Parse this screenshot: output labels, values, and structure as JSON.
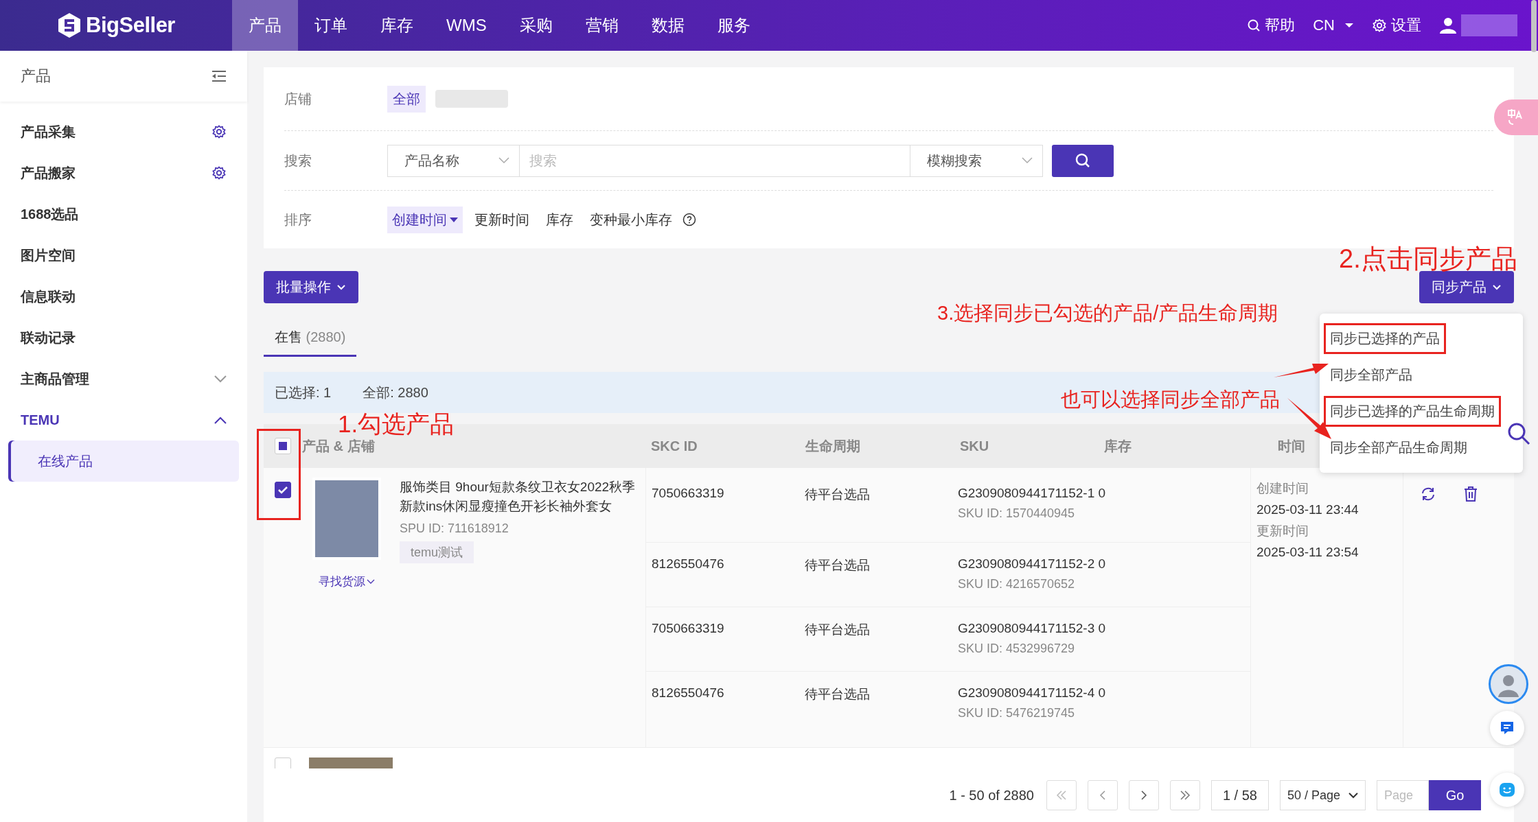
{
  "top_nav": {
    "logo": "BigSeller",
    "items": [
      {
        "label": "产品",
        "selected": true
      },
      {
        "label": "订单",
        "selected": false
      },
      {
        "label": "库存",
        "selected": false
      },
      {
        "label": "WMS",
        "selected": false
      },
      {
        "label": "采购",
        "selected": false
      },
      {
        "label": "营销",
        "selected": false
      },
      {
        "label": "数据",
        "selected": false
      },
      {
        "label": "服务",
        "selected": false
      }
    ],
    "help": "帮助",
    "language": "CN",
    "settings": "设置"
  },
  "sidebar": {
    "title": "产品",
    "items": [
      {
        "label": "产品采集",
        "kind": "gear"
      },
      {
        "label": "产品搬家",
        "kind": "gear"
      },
      {
        "label": "1688选品",
        "kind": "plain"
      },
      {
        "label": "图片空间",
        "kind": "plain"
      },
      {
        "label": "信息联动",
        "kind": "plain"
      },
      {
        "label": "联动记录",
        "kind": "plain"
      },
      {
        "label": "主商品管理",
        "kind": "group",
        "expanded": false
      },
      {
        "label": "TEMU",
        "kind": "group",
        "expanded": true,
        "children": [
          {
            "label": "在线产品",
            "selected": true
          }
        ]
      }
    ]
  },
  "filters": {
    "store_label": "店铺",
    "store_options": [
      {
        "label": "全部",
        "selected": true
      }
    ],
    "search_label": "搜索",
    "search_field": "产品名称",
    "search_placeholder": "搜索",
    "match_mode": "模糊搜索",
    "sort_label": "排序",
    "sort_options": [
      {
        "label": "创建时间",
        "selected": true,
        "help": false
      },
      {
        "label": "更新时间",
        "selected": false,
        "help": false
      },
      {
        "label": "库存",
        "selected": false,
        "help": false
      },
      {
        "label": "变种最小库存",
        "selected": false,
        "help": true
      }
    ]
  },
  "toolbar": {
    "bulk_button": "批量操作",
    "sync_button": "同步产品",
    "sync_menu": [
      {
        "label": "同步已选择的产品",
        "highlighted": true
      },
      {
        "label": "同步全部产品",
        "highlighted": false
      },
      {
        "label": "同步已选择的产品生命周期",
        "highlighted": true
      },
      {
        "label": "同步全部产品生命周期",
        "highlighted": false
      }
    ]
  },
  "tabs": [
    {
      "label": "在售",
      "count": "(2880)",
      "selected": true
    }
  ],
  "selection_bar": {
    "selected": "已选择: 1",
    "total": "全部: 2880"
  },
  "table": {
    "select_all_indeterminate": true,
    "checkboxes_highlighted": true,
    "partial_row_checked": false,
    "columns": [
      "产品 & 店铺",
      "SKC ID",
      "生命周期",
      "SKU",
      "库存",
      "时间"
    ],
    "rows": [
      {
        "checked": true,
        "title": "服饰类目 9hour短款条纹卫衣女2022秋季新款ins休闲显瘦撞色开衫长袖外套女",
        "spu": "SPU ID: 711618912",
        "store_tag": "temu测试",
        "source_link": "寻找货源",
        "variants": [
          {
            "skc": "7050663319",
            "lifecycle": "待平台选品",
            "sku": "G2309080944171152-1 0",
            "sku_id": "SKU ID: 1570440945"
          },
          {
            "skc": "8126550476",
            "lifecycle": "待平台选品",
            "sku": "G2309080944171152-2 0",
            "sku_id": "SKU ID: 4216570652"
          },
          {
            "skc": "7050663319",
            "lifecycle": "待平台选品",
            "sku": "G2309080944171152-3 0",
            "sku_id": "SKU ID: 4532996729"
          },
          {
            "skc": "8126550476",
            "lifecycle": "待平台选品",
            "sku": "G2309080944171152-4 0",
            "sku_id": "SKU ID: 5476219745"
          }
        ],
        "time": [
          {
            "label": "创建时间",
            "value": "2025-03-11 23:44"
          },
          {
            "label": "更新时间",
            "value": "2025-03-11 23:54"
          }
        ]
      }
    ]
  },
  "pagination": {
    "range": "1 - 50 of 2880",
    "page": "1 / 58",
    "page_size": "50 / Page",
    "page_placeholder": "Page",
    "go": "Go"
  },
  "annotations": [
    "1.勾选产品",
    "2.点击同步产品",
    "3.选择同步已勾选的产品/产品生命周期",
    "也可以选择同步全部产品"
  ]
}
